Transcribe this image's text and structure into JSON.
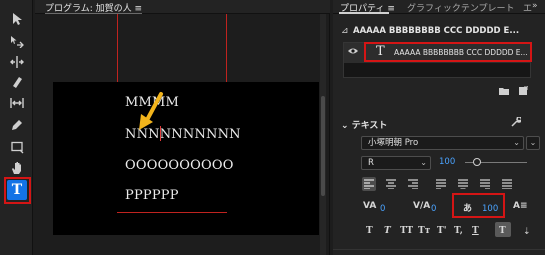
{
  "monitor": {
    "title": "プログラム: 加賀の人",
    "title_menu_icon": "hamburger-icon",
    "video_text_lines": [
      "MMMM",
      "NNNNNNNNNN",
      "OOOOOOOOOO",
      "PPPPPP"
    ]
  },
  "tools": [
    {
      "name": "selection-tool",
      "icon": "arrow-icon"
    },
    {
      "name": "track-select-tool",
      "icon": "track-select-icon"
    },
    {
      "name": "ripple-edit-tool",
      "icon": "ripple-icon"
    },
    {
      "name": "razor-tool",
      "icon": "razor-icon"
    },
    {
      "name": "slip-tool",
      "icon": "slip-icon"
    },
    {
      "name": "pen-tool",
      "icon": "pen-icon"
    },
    {
      "name": "rectangle-tool",
      "icon": "rectangle-icon"
    },
    {
      "name": "hand-tool",
      "icon": "hand-icon"
    },
    {
      "name": "type-tool",
      "icon": "type-icon",
      "label": "T",
      "active": true
    }
  ],
  "panel": {
    "tabs": [
      {
        "label": "プロパティ ≡",
        "active": true
      },
      {
        "label": "グラフィックテンプレート",
        "active": false
      },
      {
        "label": "エ",
        "active": false
      }
    ],
    "more_label": "»",
    "clip_title": "AAAAA BBBBBBBB CCC DDDDD E...",
    "layer": {
      "glyph": "T",
      "name": "AAAAA BBBBBBBB CCC DDDDD E..."
    },
    "text_section": {
      "header": "テキスト",
      "font_family": "小塚明朝 Pro",
      "font_style": "R",
      "font_size": "100",
      "tracking": "0",
      "kerning": "0",
      "tsume": "100",
      "style_buttons": [
        "T",
        "T",
        "TT",
        "Tт",
        "T'",
        "T,",
        "T",
        "T"
      ]
    }
  },
  "colors": {
    "accent_blue": "#1473e6",
    "value_blue": "#4aa3ff",
    "highlight_red": "#d41515",
    "arrow_yellow": "#f2b41c"
  }
}
